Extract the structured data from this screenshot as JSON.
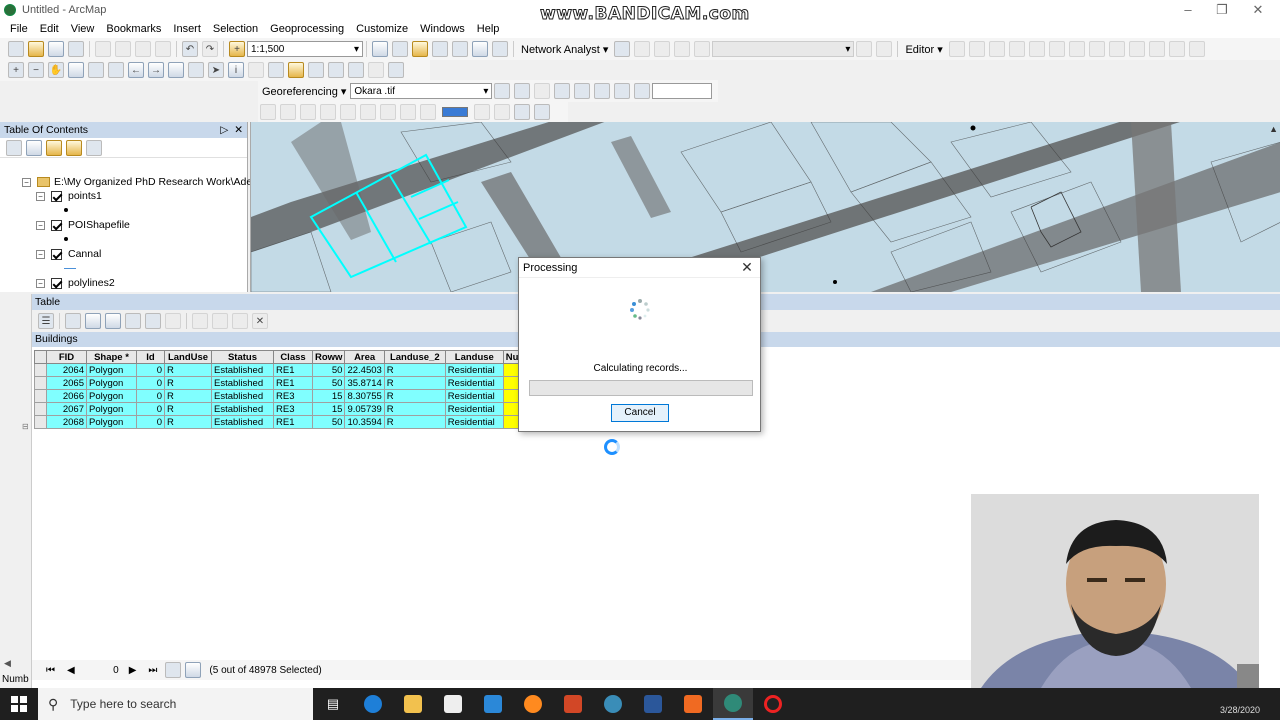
{
  "window": {
    "title": "Untitled - ArcMap",
    "watermark": "www.BANDICAM.com"
  },
  "menu": [
    "File",
    "Edit",
    "View",
    "Bookmarks",
    "Insert",
    "Selection",
    "Geoprocessing",
    "Customize",
    "Windows",
    "Help"
  ],
  "toolbar": {
    "scale": "1:1,500",
    "network_analyst": "Network Analyst ▾",
    "editor": "Editor ▾",
    "georeferencing": "Georeferencing ▾",
    "raster_layer": "Okara .tif"
  },
  "toc": {
    "title": "Table Of Contents",
    "folder": "E:\\My Organized PhD Research Work\\Adeel O",
    "layers": [
      "points1",
      "POIShapefile",
      "Cannal",
      "polylines2"
    ]
  },
  "table": {
    "title": "Table",
    "layer_tab": "Buildings",
    "columns": [
      "FID",
      "Shape *",
      "Id",
      "LandUse",
      "Status",
      "Class",
      "Roww",
      "Area",
      "Landuse_2",
      "Landuse",
      "Numb"
    ],
    "rows": [
      [
        "2064",
        "Polygon",
        "0",
        "R",
        "Established",
        "RE1",
        "50",
        "22.4503",
        "R",
        "Residential",
        ""
      ],
      [
        "2065",
        "Polygon",
        "0",
        "R",
        "Established",
        "RE1",
        "50",
        "35.8714",
        "R",
        "Residential",
        ""
      ],
      [
        "2066",
        "Polygon",
        "0",
        "R",
        "Established",
        "RE3",
        "15",
        "8.30755",
        "R",
        "Residential",
        ""
      ],
      [
        "2067",
        "Polygon",
        "0",
        "R",
        "Established",
        "RE3",
        "15",
        "9.05739",
        "R",
        "Residential",
        ""
      ],
      [
        "2068",
        "Polygon",
        "0",
        "R",
        "Established",
        "RE1",
        "50",
        "10.3594",
        "R",
        "Residential",
        ""
      ]
    ],
    "record_index": "0",
    "selection_status": "(5 out of 48978 Selected)",
    "bottom_label": "Numb"
  },
  "dialog": {
    "title": "Processing",
    "message": "Calculating records...",
    "cancel": "Cancel",
    "progress": 0
  },
  "taskbar": {
    "search_placeholder": "Type here to search",
    "date": "3/28/2020"
  }
}
